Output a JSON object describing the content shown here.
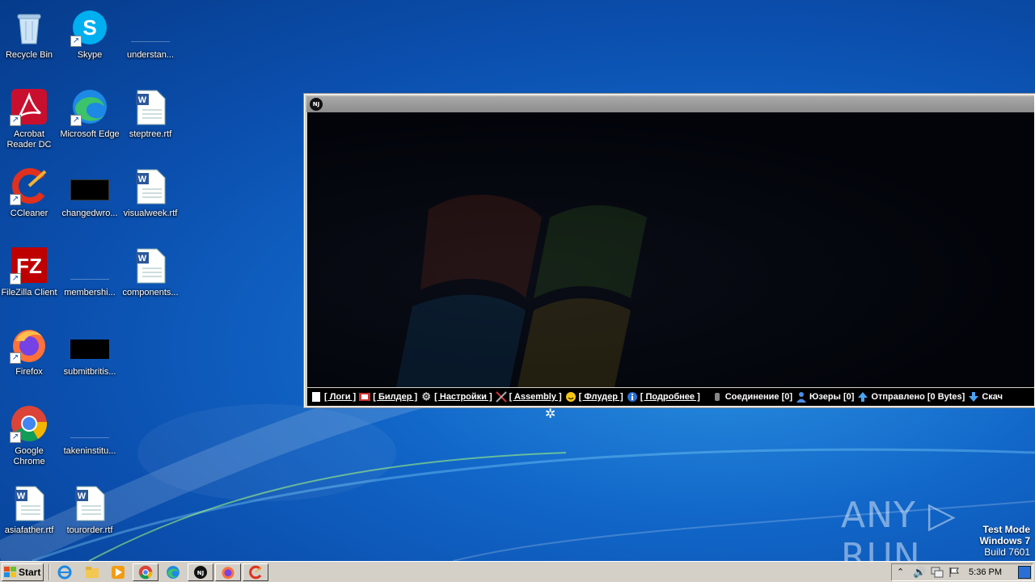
{
  "desktop": {
    "icons": [
      {
        "label": "Recycle Bin"
      },
      {
        "label": "Skype"
      },
      {
        "label": "understan..."
      },
      {
        "label": "Acrobat Reader DC"
      },
      {
        "label": "Microsoft Edge"
      },
      {
        "label": "steptree.rtf"
      },
      {
        "label": "CCleaner"
      },
      {
        "label": "changedwro..."
      },
      {
        "label": "visualweek.rtf"
      },
      {
        "label": "FileZilla Client"
      },
      {
        "label": "membershi..."
      },
      {
        "label": "components..."
      },
      {
        "label": "Firefox"
      },
      {
        "label": "submitbritis..."
      },
      {
        "label": "Google Chrome"
      },
      {
        "label": "takeninstitu..."
      },
      {
        "label": "asiafather.rtf"
      },
      {
        "label": "tourorder.rtf"
      }
    ]
  },
  "app_window": {
    "logo_text": "NJ",
    "statusbar": {
      "logs": "[ Логи ]",
      "builder": "[ Билдер ]",
      "settings": "[ Настройки ]",
      "assembly": "[ Assembly ]",
      "flooder": "[ Флудер ]",
      "more": "[ Подробнее ]",
      "connection": "Соединение [0]",
      "users": "Юзеры [0]",
      "sent": "Отправлено [0 Bytes]",
      "received": "Скач"
    }
  },
  "watermark": {
    "text": "ANY ▷ RUN"
  },
  "test_mode": {
    "line1": "Test Mode",
    "line2": "Windows 7",
    "line3": "Build 7601"
  },
  "taskbar": {
    "start_label": "Start",
    "clock": "5:36 PM"
  }
}
